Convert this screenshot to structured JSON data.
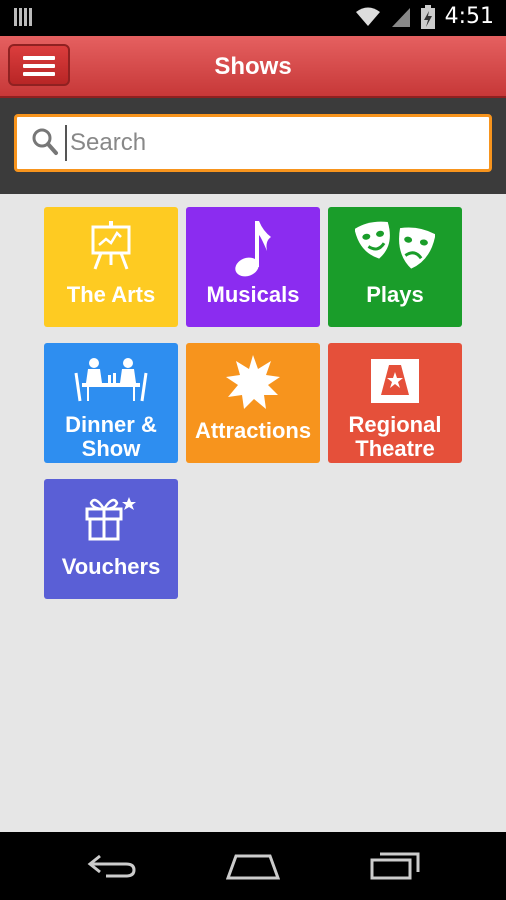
{
  "status_bar": {
    "time": "4:51"
  },
  "app_bar": {
    "title": "Shows"
  },
  "search": {
    "placeholder": "Search"
  },
  "tiles": [
    {
      "label": "The Arts",
      "color": "#fecb22",
      "icon": "easel-icon"
    },
    {
      "label": "Musicals",
      "color": "#8b2cf0",
      "icon": "music-note-icon"
    },
    {
      "label": "Plays",
      "color": "#1a9d2a",
      "icon": "theatre-masks-icon"
    },
    {
      "label": "Dinner & Show",
      "color": "#2e8ef0",
      "icon": "dinner-table-icon"
    },
    {
      "label": "Attractions",
      "color": "#f7941d",
      "icon": "star-burst-icon"
    },
    {
      "label": "Regional Theatre",
      "color": "#e5503a",
      "icon": "stage-icon"
    },
    {
      "label": "Vouchers",
      "color": "#5a5fd6",
      "icon": "gift-icon"
    }
  ]
}
